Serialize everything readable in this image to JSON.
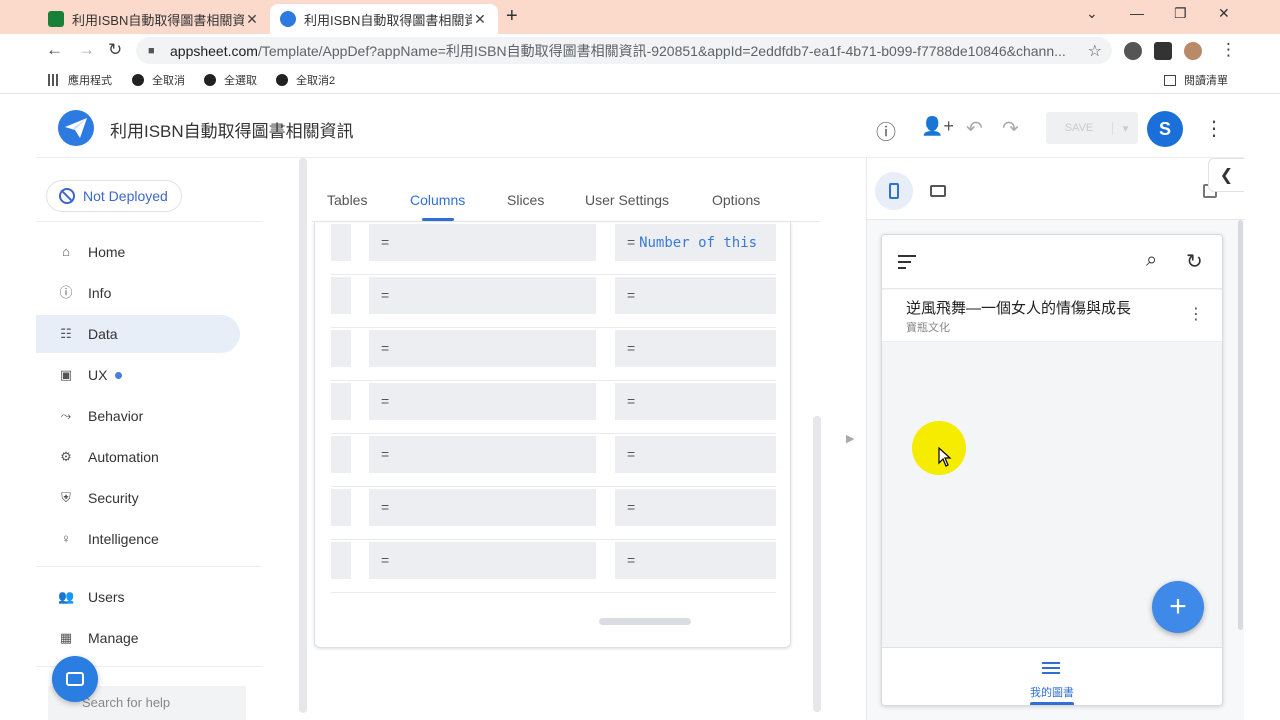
{
  "browser": {
    "tabs": [
      {
        "title": "利用ISBN自動取得圖書相關資訊",
        "favicon_color": "#188038",
        "active": false
      },
      {
        "title": "利用ISBN自動取得圖書相關資訊",
        "favicon_color": "#2d7ae0",
        "active": true
      }
    ],
    "url_host": "appsheet.com",
    "url_path": "/Template/AppDef?appName=利用ISBN自動取得圖書相關資訊-920851&appId=2eddfdb7-ea1f-4b71-b099-f7788de10846&chann...",
    "bookmarks": [
      "應用程式",
      "全取消",
      "全選取",
      "全取消2"
    ],
    "reading_list": "閱讀清單"
  },
  "app": {
    "title": "利用ISBN自動取得圖書相關資訊",
    "save_label": "SAVE",
    "avatar_letter": "S",
    "brand_color": "#2d7ae0"
  },
  "sidebar": {
    "deploy_status": "Not Deployed",
    "items": [
      {
        "label": "Home",
        "icon": "home-icon",
        "active": false
      },
      {
        "label": "Info",
        "icon": "info-icon",
        "active": false
      },
      {
        "label": "Data",
        "icon": "data-icon",
        "active": true
      },
      {
        "label": "UX",
        "icon": "ux-icon",
        "active": false,
        "dot": true
      },
      {
        "label": "Behavior",
        "icon": "behavior-icon",
        "active": false
      },
      {
        "label": "Automation",
        "icon": "automation-icon",
        "active": false
      },
      {
        "label": "Security",
        "icon": "shield-icon",
        "active": false
      },
      {
        "label": "Intelligence",
        "icon": "lightbulb-icon",
        "active": false
      },
      {
        "label": "Users",
        "icon": "users-icon",
        "active": false
      },
      {
        "label": "Manage",
        "icon": "manage-icon",
        "active": false
      }
    ],
    "help_placeholder": "Search for help"
  },
  "data_tabs": [
    "Tables",
    "Columns",
    "Slices",
    "User Settings",
    "Options"
  ],
  "active_data_tab": "Columns",
  "column_rows": [
    {
      "c1": "=",
      "c2_prefix": "=",
      "c2_formula": "Number of this"
    },
    {
      "c1": "=",
      "c2_prefix": "=",
      "c2_formula": ""
    },
    {
      "c1": "=",
      "c2_prefix": "=",
      "c2_formula": ""
    },
    {
      "c1": "=",
      "c2_prefix": "=",
      "c2_formula": ""
    },
    {
      "c1": "=",
      "c2_prefix": "=",
      "c2_formula": ""
    },
    {
      "c1": "=",
      "c2_prefix": "=",
      "c2_formula": ""
    },
    {
      "c1": "=",
      "c2_prefix": "=",
      "c2_formula": ""
    }
  ],
  "preview": {
    "list_item": {
      "title": "逆風飛舞—一個女人的情傷與成長",
      "subtitle": "寶瓶文化"
    },
    "nav_label": "我的圖書"
  }
}
